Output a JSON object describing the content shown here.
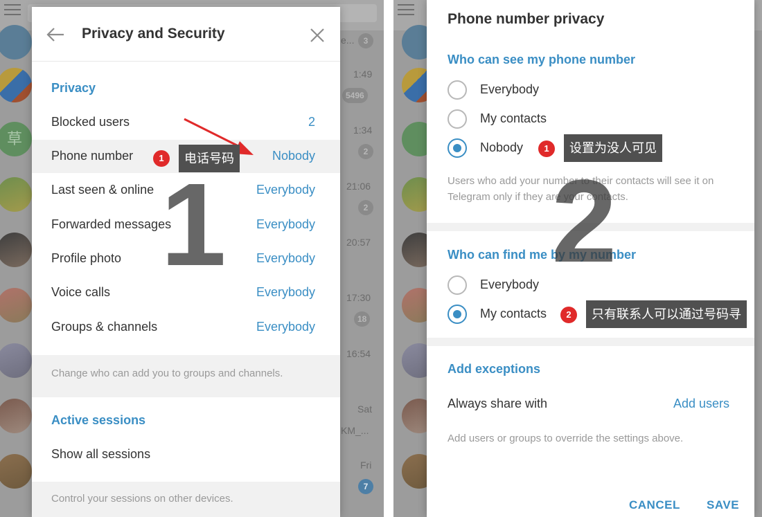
{
  "left": {
    "background": {
      "times": [
        "1:49",
        "1:34",
        "21:06",
        "20:57",
        "17:30",
        "16:54",
        "Sat",
        "Fri"
      ],
      "badges": [
        "3",
        "5496",
        "2",
        "2",
        "18",
        "7"
      ],
      "snippets": [
        "e...",
        "KM_..."
      ],
      "avatar_text": "草"
    },
    "dialog": {
      "title": "Privacy and Security",
      "privacy_section": "Privacy",
      "rows": [
        {
          "label": "Blocked users",
          "value": "2"
        },
        {
          "label": "Phone number",
          "value": "Nobody"
        },
        {
          "label": "Last seen & online",
          "value": "Everybody"
        },
        {
          "label": "Forwarded messages",
          "value": "Everybody"
        },
        {
          "label": "Profile photo",
          "value": "Everybody"
        },
        {
          "label": "Voice calls",
          "value": "Everybody"
        },
        {
          "label": "Groups & channels",
          "value": "Everybody"
        }
      ],
      "groups_hint": "Change who can add you to groups and channels.",
      "sessions_section": "Active sessions",
      "show_sessions": "Show all sessions",
      "sessions_hint": "Control your sessions on other devices."
    },
    "annotation": {
      "step": "1",
      "badge": "1",
      "callout": "电话号码"
    }
  },
  "right": {
    "dialog": {
      "title": "Phone number privacy",
      "see_section": "Who can see my phone number",
      "see_options": [
        {
          "label": "Everybody",
          "selected": false
        },
        {
          "label": "My contacts",
          "selected": false
        },
        {
          "label": "Nobody",
          "selected": true
        }
      ],
      "see_hint": "Users who add your number to their contacts will see it on Telegram only if they are your contacts.",
      "find_section": "Who can find me by my number",
      "find_options": [
        {
          "label": "Everybody",
          "selected": false
        },
        {
          "label": "My contacts",
          "selected": true
        }
      ],
      "exceptions_section": "Add exceptions",
      "always_share_label": "Always share with",
      "add_users": "Add users",
      "exceptions_hint": "Add users or groups to override the settings above.",
      "cancel": "CANCEL",
      "save": "SAVE"
    },
    "annotation": {
      "step": "2",
      "badge1": "1",
      "callout1": "设置为没人可见",
      "badge2": "2",
      "callout2": "只有联系人可以通过号码寻"
    }
  },
  "colors": {
    "accent": "#3a8ec4",
    "annotation_red": "#e02a2a",
    "callout_bg": "#505050"
  }
}
